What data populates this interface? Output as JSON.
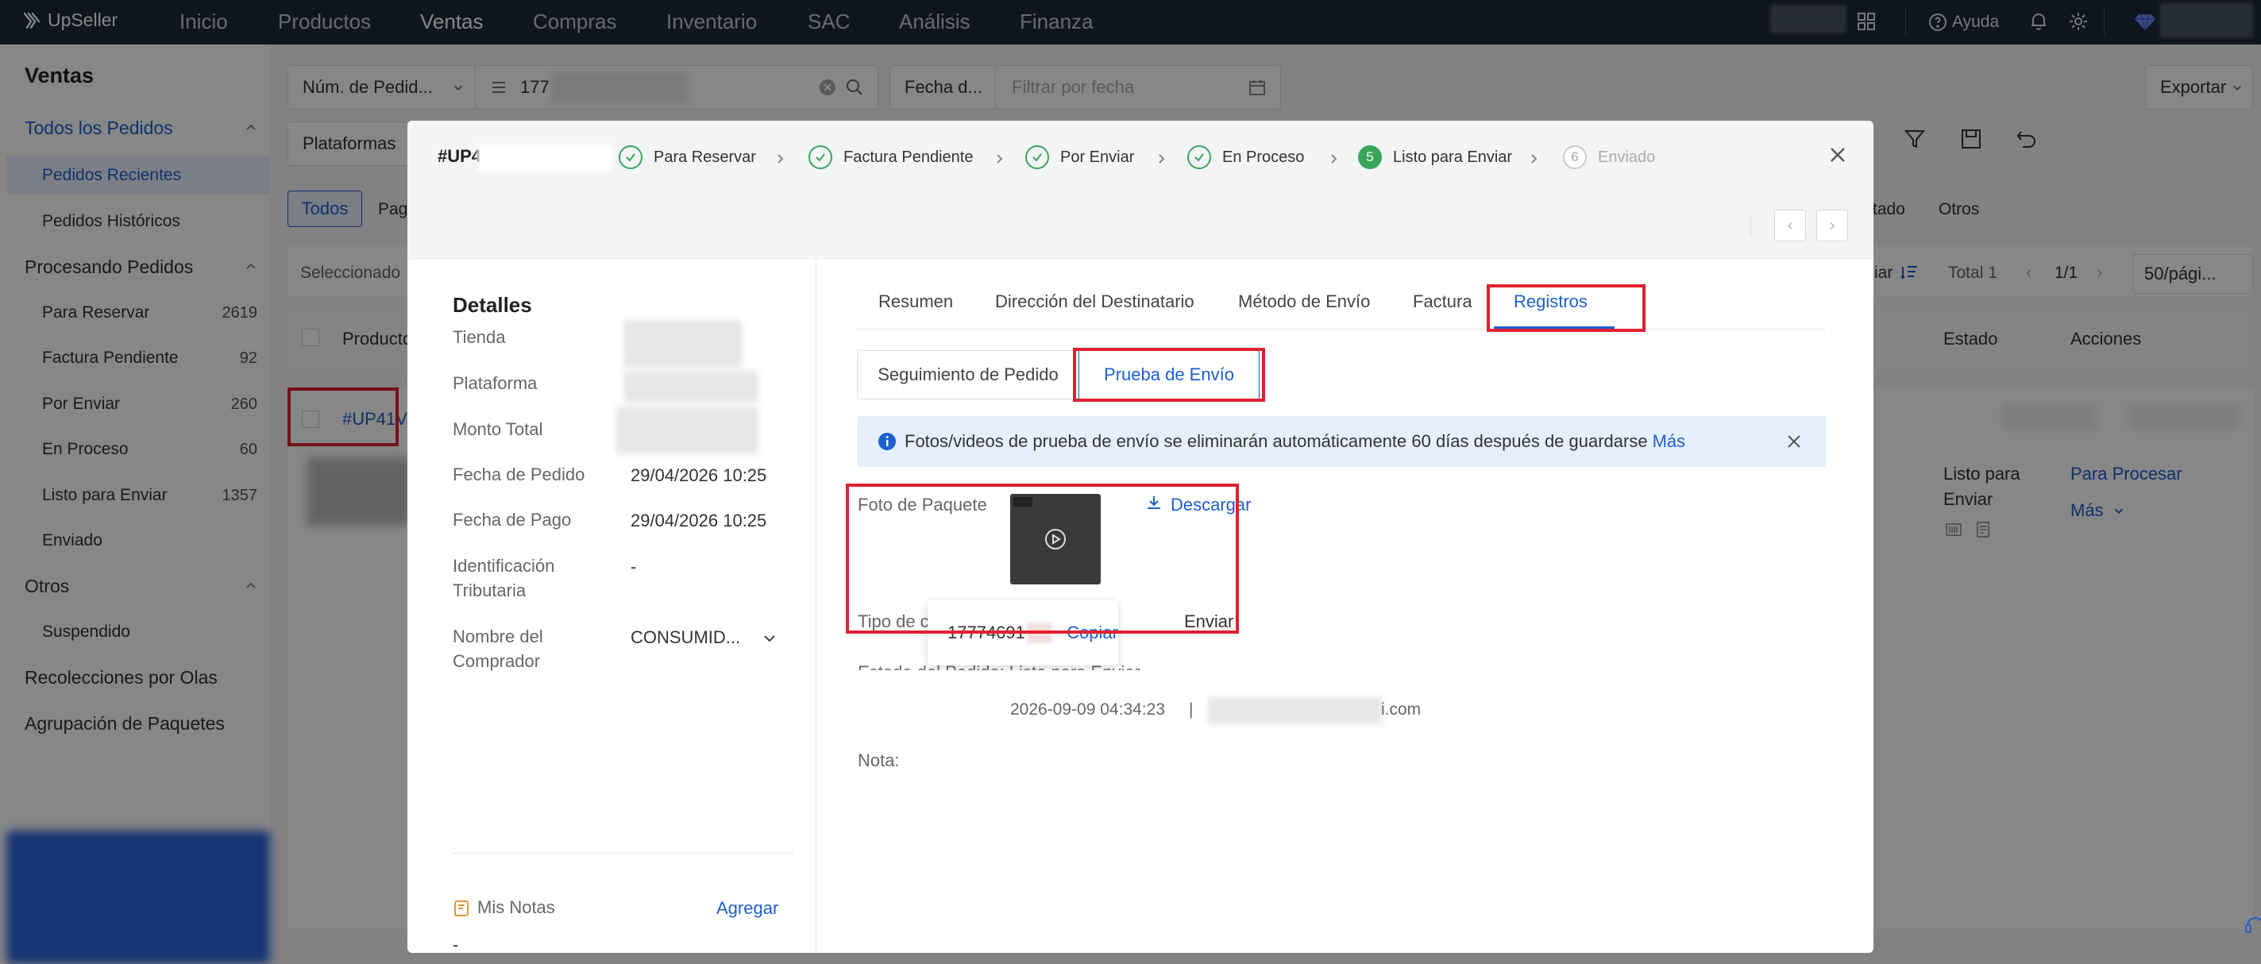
{
  "topnav": {
    "logo": "UpSeller",
    "items": [
      "Inicio",
      "Productos",
      "Ventas",
      "Compras",
      "Inventario",
      "SAC",
      "Análisis",
      "Finanza"
    ],
    "active": "Ventas",
    "help": "Ayuda"
  },
  "sidebar": {
    "title": "Ventas",
    "all_orders": "Todos los Pedidos",
    "recent": "Pedidos Recientes",
    "historic": "Pedidos Históricos",
    "processing": "Procesando Pedidos",
    "items": [
      {
        "label": "Para Reservar",
        "count": "2619"
      },
      {
        "label": "Factura Pendiente",
        "count": "92"
      },
      {
        "label": "Por Enviar",
        "count": "260"
      },
      {
        "label": "En Proceso",
        "count": "60"
      },
      {
        "label": "Listo para Enviar",
        "count": "1357"
      },
      {
        "label": "Enviado",
        "count": ""
      }
    ],
    "others": "Otros",
    "suspended": "Suspendido",
    "waves": "Recolecciones por Olas",
    "grouping": "Agrupación de Paquetes"
  },
  "main": {
    "search_field": "Núm. de Pedid...",
    "search_value": "177",
    "date_field": "Fecha d...",
    "date_placeholder": "Filtrar por fecha",
    "export": "Exportar",
    "platforms": "Plataformas",
    "tab_all": "Todos",
    "tab_pag": "Pag",
    "tab_estado_partial": "tado",
    "tab_otros": "Otros",
    "selected": "Seleccionado",
    "iar": "iar",
    "total": "Total 1",
    "page": "1/1",
    "per_page": "50/pági...",
    "col_product": "Producto",
    "col_state": "Estado",
    "col_actions": "Acciones",
    "order_id": "#UP41V",
    "row_state": "Listo para Enviar",
    "row_state_l1": "Listo para",
    "row_state_l2": "Enviar",
    "action_process": "Para Procesar",
    "action_more": "Más"
  },
  "modal": {
    "order_id": "#UP4",
    "steps": [
      {
        "label": "Para Reservar",
        "state": "done"
      },
      {
        "label": "Factura Pendiente",
        "state": "done"
      },
      {
        "label": "Por Enviar",
        "state": "done"
      },
      {
        "label": "En Proceso",
        "state": "done"
      },
      {
        "label": "Listo para Enviar",
        "state": "current",
        "num": "5"
      },
      {
        "label": "Enviado",
        "state": "todo",
        "num": "6"
      }
    ],
    "details": {
      "title": "Detalles",
      "store": "Tienda",
      "platform": "Plataforma",
      "total": "Monto Total",
      "order_date_label": "Fecha de Pedido",
      "order_date": "29/04/2026 10:25",
      "pay_date_label": "Fecha de Pago",
      "pay_date": "29/04/2026 10:25",
      "tax_label_1": "Identificación",
      "tax_label_2": "Tributaria",
      "tax_value": "-",
      "buyer_label_1": "Nombre del",
      "buyer_label_2": "Comprador",
      "buyer_value": "CONSUMID...",
      "notes_label": "Mis Notas",
      "add": "Agregar",
      "notes_value": "-"
    },
    "tabs": [
      "Resumen",
      "Dirección del Destinatario",
      "Método de Envío",
      "Factura",
      "Registros"
    ],
    "active_tab": "Registros",
    "subtabs": [
      "Seguimiento de Pedido",
      "Prueba de Envío"
    ],
    "active_subtab": "Prueba de Envío",
    "info": "Fotos/videos de prueba de envío se eliminarán automáticamente 60 días después de guardarse",
    "info_more": "Más",
    "photo_label": "Foto de Paquete",
    "download": "Descargar",
    "type_label": "Tipo de c",
    "type_value": "Enviar",
    "tooltip_number": "17774691",
    "tooltip_copy": "Copiar",
    "state_partial": "Estado del Pedido: Listo para Enviar",
    "timestamp": "2026-09-09 04:34:23",
    "pipe": "|",
    "email_suffix": "i.com",
    "note_label": "Nota:"
  },
  "colors": {
    "nav_bg": "#1f2b3d",
    "accent": "#1d5fcf",
    "success": "#3aa55a",
    "highlight": "#e02030"
  }
}
